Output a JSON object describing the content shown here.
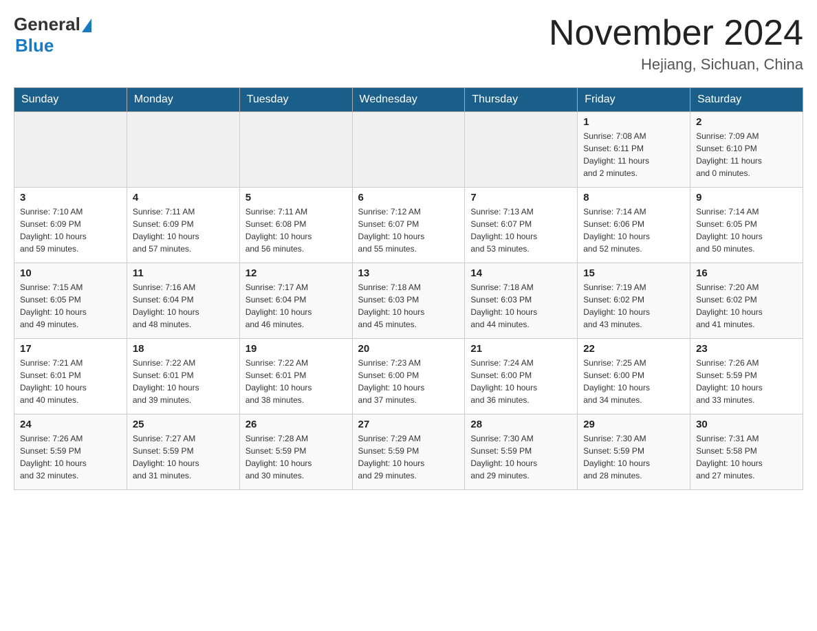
{
  "header": {
    "logo": {
      "general": "General",
      "blue": "Blue"
    },
    "title": "November 2024",
    "location": "Hejiang, Sichuan, China"
  },
  "days_of_week": [
    "Sunday",
    "Monday",
    "Tuesday",
    "Wednesday",
    "Thursday",
    "Friday",
    "Saturday"
  ],
  "weeks": [
    [
      {
        "day": "",
        "info": ""
      },
      {
        "day": "",
        "info": ""
      },
      {
        "day": "",
        "info": ""
      },
      {
        "day": "",
        "info": ""
      },
      {
        "day": "",
        "info": ""
      },
      {
        "day": "1",
        "info": "Sunrise: 7:08 AM\nSunset: 6:11 PM\nDaylight: 11 hours\nand 2 minutes."
      },
      {
        "day": "2",
        "info": "Sunrise: 7:09 AM\nSunset: 6:10 PM\nDaylight: 11 hours\nand 0 minutes."
      }
    ],
    [
      {
        "day": "3",
        "info": "Sunrise: 7:10 AM\nSunset: 6:09 PM\nDaylight: 10 hours\nand 59 minutes."
      },
      {
        "day": "4",
        "info": "Sunrise: 7:11 AM\nSunset: 6:09 PM\nDaylight: 10 hours\nand 57 minutes."
      },
      {
        "day": "5",
        "info": "Sunrise: 7:11 AM\nSunset: 6:08 PM\nDaylight: 10 hours\nand 56 minutes."
      },
      {
        "day": "6",
        "info": "Sunrise: 7:12 AM\nSunset: 6:07 PM\nDaylight: 10 hours\nand 55 minutes."
      },
      {
        "day": "7",
        "info": "Sunrise: 7:13 AM\nSunset: 6:07 PM\nDaylight: 10 hours\nand 53 minutes."
      },
      {
        "day": "8",
        "info": "Sunrise: 7:14 AM\nSunset: 6:06 PM\nDaylight: 10 hours\nand 52 minutes."
      },
      {
        "day": "9",
        "info": "Sunrise: 7:14 AM\nSunset: 6:05 PM\nDaylight: 10 hours\nand 50 minutes."
      }
    ],
    [
      {
        "day": "10",
        "info": "Sunrise: 7:15 AM\nSunset: 6:05 PM\nDaylight: 10 hours\nand 49 minutes."
      },
      {
        "day": "11",
        "info": "Sunrise: 7:16 AM\nSunset: 6:04 PM\nDaylight: 10 hours\nand 48 minutes."
      },
      {
        "day": "12",
        "info": "Sunrise: 7:17 AM\nSunset: 6:04 PM\nDaylight: 10 hours\nand 46 minutes."
      },
      {
        "day": "13",
        "info": "Sunrise: 7:18 AM\nSunset: 6:03 PM\nDaylight: 10 hours\nand 45 minutes."
      },
      {
        "day": "14",
        "info": "Sunrise: 7:18 AM\nSunset: 6:03 PM\nDaylight: 10 hours\nand 44 minutes."
      },
      {
        "day": "15",
        "info": "Sunrise: 7:19 AM\nSunset: 6:02 PM\nDaylight: 10 hours\nand 43 minutes."
      },
      {
        "day": "16",
        "info": "Sunrise: 7:20 AM\nSunset: 6:02 PM\nDaylight: 10 hours\nand 41 minutes."
      }
    ],
    [
      {
        "day": "17",
        "info": "Sunrise: 7:21 AM\nSunset: 6:01 PM\nDaylight: 10 hours\nand 40 minutes."
      },
      {
        "day": "18",
        "info": "Sunrise: 7:22 AM\nSunset: 6:01 PM\nDaylight: 10 hours\nand 39 minutes."
      },
      {
        "day": "19",
        "info": "Sunrise: 7:22 AM\nSunset: 6:01 PM\nDaylight: 10 hours\nand 38 minutes."
      },
      {
        "day": "20",
        "info": "Sunrise: 7:23 AM\nSunset: 6:00 PM\nDaylight: 10 hours\nand 37 minutes."
      },
      {
        "day": "21",
        "info": "Sunrise: 7:24 AM\nSunset: 6:00 PM\nDaylight: 10 hours\nand 36 minutes."
      },
      {
        "day": "22",
        "info": "Sunrise: 7:25 AM\nSunset: 6:00 PM\nDaylight: 10 hours\nand 34 minutes."
      },
      {
        "day": "23",
        "info": "Sunrise: 7:26 AM\nSunset: 5:59 PM\nDaylight: 10 hours\nand 33 minutes."
      }
    ],
    [
      {
        "day": "24",
        "info": "Sunrise: 7:26 AM\nSunset: 5:59 PM\nDaylight: 10 hours\nand 32 minutes."
      },
      {
        "day": "25",
        "info": "Sunrise: 7:27 AM\nSunset: 5:59 PM\nDaylight: 10 hours\nand 31 minutes."
      },
      {
        "day": "26",
        "info": "Sunrise: 7:28 AM\nSunset: 5:59 PM\nDaylight: 10 hours\nand 30 minutes."
      },
      {
        "day": "27",
        "info": "Sunrise: 7:29 AM\nSunset: 5:59 PM\nDaylight: 10 hours\nand 29 minutes."
      },
      {
        "day": "28",
        "info": "Sunrise: 7:30 AM\nSunset: 5:59 PM\nDaylight: 10 hours\nand 29 minutes."
      },
      {
        "day": "29",
        "info": "Sunrise: 7:30 AM\nSunset: 5:59 PM\nDaylight: 10 hours\nand 28 minutes."
      },
      {
        "day": "30",
        "info": "Sunrise: 7:31 AM\nSunset: 5:58 PM\nDaylight: 10 hours\nand 27 minutes."
      }
    ]
  ]
}
